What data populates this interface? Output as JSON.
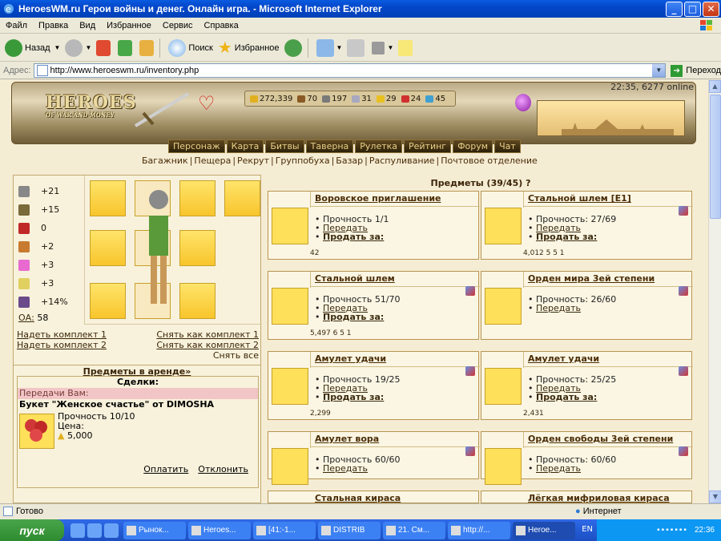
{
  "window": {
    "title": "HeroesWM.ru Герои войны и денег. Онлайн игра. - Microsoft Internet Explorer"
  },
  "menu": [
    "Файл",
    "Правка",
    "Вид",
    "Избранное",
    "Сервис",
    "Справка"
  ],
  "toolbar": {
    "back": "Назад",
    "search": "Поиск",
    "favorites": "Избранное"
  },
  "address": {
    "label": "Адрес:",
    "url": "http://www.heroeswm.ru/inventory.php",
    "go": "Переход"
  },
  "game": {
    "logo_main": "HEROES",
    "logo_sub": "OF WAR AND MONEY",
    "online": "22:35, 6277 online",
    "resources": [
      {
        "icon": "gold-icon",
        "value": "272,339",
        "color": "#e0b020"
      },
      {
        "icon": "wood-icon",
        "value": "70",
        "color": "#8a5a24"
      },
      {
        "icon": "ore-icon",
        "value": "197",
        "color": "#7a7a7a"
      },
      {
        "icon": "mercury-icon",
        "value": "31",
        "color": "#a8a8c0"
      },
      {
        "icon": "sulfur-icon",
        "value": "29",
        "color": "#e8c020"
      },
      {
        "icon": "crystal-icon",
        "value": "24",
        "color": "#d03030"
      },
      {
        "icon": "gems-icon",
        "value": "45",
        "color": "#40a0d0"
      }
    ],
    "nav": [
      "Персонаж",
      "Карта",
      "Битвы",
      "Таверна",
      "Рулетка",
      "Рейтинг",
      "Форум",
      "Чат"
    ],
    "sublinks": [
      "Багажник",
      "Пещера",
      "Рекрут",
      "Группобуха",
      "Базар",
      "Распуливание",
      "Почтовое отделение"
    ]
  },
  "stats": [
    {
      "icon": "attack-icon",
      "value": "+21",
      "color": "#888"
    },
    {
      "icon": "defense-icon",
      "value": "+15",
      "color": "#7a6a3a"
    },
    {
      "icon": "spellpower-icon",
      "value": "0",
      "color": "#c02828"
    },
    {
      "icon": "knowledge-icon",
      "value": "+2",
      "color": "#c87a30"
    },
    {
      "icon": "luck-icon",
      "value": "+3",
      "color": "#e86ad0"
    },
    {
      "icon": "morale-icon",
      "value": "+3",
      "color": "#e0d060"
    },
    {
      "icon": "initiative-icon",
      "value": "+14%",
      "color": "#6a4a8a"
    }
  ],
  "oa": {
    "label": "ОА:",
    "value": "58"
  },
  "kit": {
    "wear1": "Надеть комплект 1",
    "remove1": "Снять как комплект 1",
    "wear2": "Надеть комплект 2",
    "remove2": "Снять как комплект 2",
    "remove_all": "Снять все"
  },
  "rent_link": "Предметы в аренде»",
  "deals": {
    "title": "Сделки:",
    "transfer": "Передачи Вам:",
    "name": "Букет \"Женское счастье\" от DIMOSHA",
    "durability": "Прочность 10/10",
    "price_label": "Цена:",
    "price": "5,000",
    "pay": "Оплатить",
    "decline": "Отклонить"
  },
  "items_header": "Предметы (39/45) ?",
  "items": [
    {
      "name": "Воровское приглашение",
      "dur": "Прочность 1/1",
      "transfer": "Передать",
      "sell": "Продать за:",
      "cost": "42"
    },
    {
      "name": "Стальной шлем [E1]",
      "dur": "Прочность: 27/69",
      "transfer": "Передать",
      "sell": "Продать за:",
      "cost": "4,012 5 5 1"
    },
    {
      "name": "Стальной шлем",
      "dur": "Прочность 51/70",
      "transfer": "Передать",
      "sell": "Продать за:",
      "cost": "5,497 6 5 1"
    },
    {
      "name": "Орден мира 3ей степени",
      "dur": "Прочность: 26/60",
      "transfer": "Передать",
      "sell": "",
      "cost": ""
    },
    {
      "name": "Амулет удачи",
      "dur": "Прочность 19/25",
      "transfer": "Передать",
      "sell": "Продать за:",
      "cost": "2,299"
    },
    {
      "name": "Амулет удачи",
      "dur": "Прочность: 25/25",
      "transfer": "Передать",
      "sell": "Продать за:",
      "cost": "2,431"
    },
    {
      "name": "Амулет вора",
      "dur": "Прочность 60/60",
      "transfer": "Передать",
      "sell": "",
      "cost": ""
    },
    {
      "name": "Орден свободы 3ей степени",
      "dur": "Прочность: 60/60",
      "transfer": "Передать",
      "sell": "",
      "cost": ""
    },
    {
      "name": "Стальная кираса",
      "dur": "",
      "transfer": "",
      "sell": "",
      "cost": ""
    },
    {
      "name": "Лёгкая мифриловая кираса",
      "dur": "",
      "transfer": "",
      "sell": "",
      "cost": ""
    }
  ],
  "status": {
    "left": "Готово",
    "zone": "Интернет"
  },
  "taskbar": {
    "start": "пуск",
    "tasks": [
      "Рынок...",
      "Heroes...",
      "[41:-1...",
      "DISTRIB",
      "21. См...",
      "http://...",
      "Heroe..."
    ],
    "lang": "EN",
    "clock": "22:36"
  }
}
